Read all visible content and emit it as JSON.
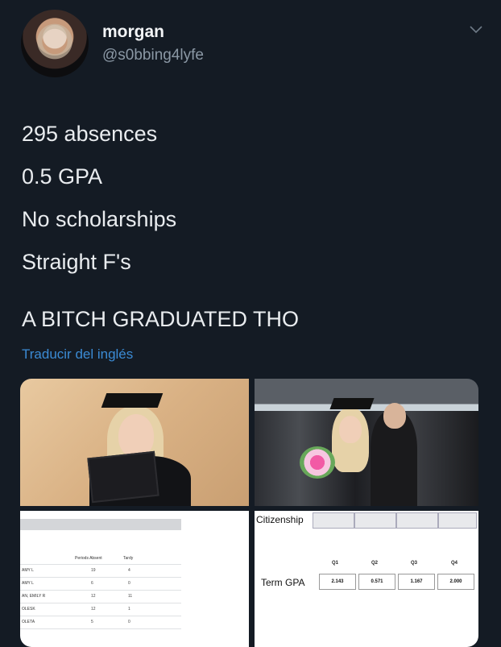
{
  "user": {
    "display_name": "morgan",
    "handle": "@s0bbing4lyfe"
  },
  "tweet": {
    "lines": [
      "295 absences",
      "0.5 GPA",
      "No scholarships",
      "Straight F's"
    ],
    "closing": "A BITCH GRADUATED THO",
    "translate_link": "Traducir del inglés"
  },
  "media": {
    "attendance": {
      "col_absent": "Periods Absent",
      "col_tardy": "Tardy",
      "rows": [
        {
          "label": "AMY L",
          "absent": "19",
          "tardy": "4"
        },
        {
          "label": "AMY L",
          "absent": "6",
          "tardy": "0"
        },
        {
          "label": "AN, EMILY R",
          "absent": "12",
          "tardy": "11"
        },
        {
          "label": "OLESK",
          "absent": "12",
          "tardy": "1"
        },
        {
          "label": "OLETA",
          "absent": "5",
          "tardy": "0"
        }
      ]
    },
    "grades": {
      "citizenship_label": "Citizenship",
      "quarters": [
        "Q1",
        "Q2",
        "Q3",
        "Q4"
      ],
      "term_gpa_label": "Term GPA",
      "term_gpa": [
        "2.143",
        "0.571",
        "1.167",
        "2.000"
      ]
    }
  },
  "colors": {
    "background": "#141b24",
    "link": "#3b8bd4",
    "secondary_text": "#8b98a5"
  }
}
